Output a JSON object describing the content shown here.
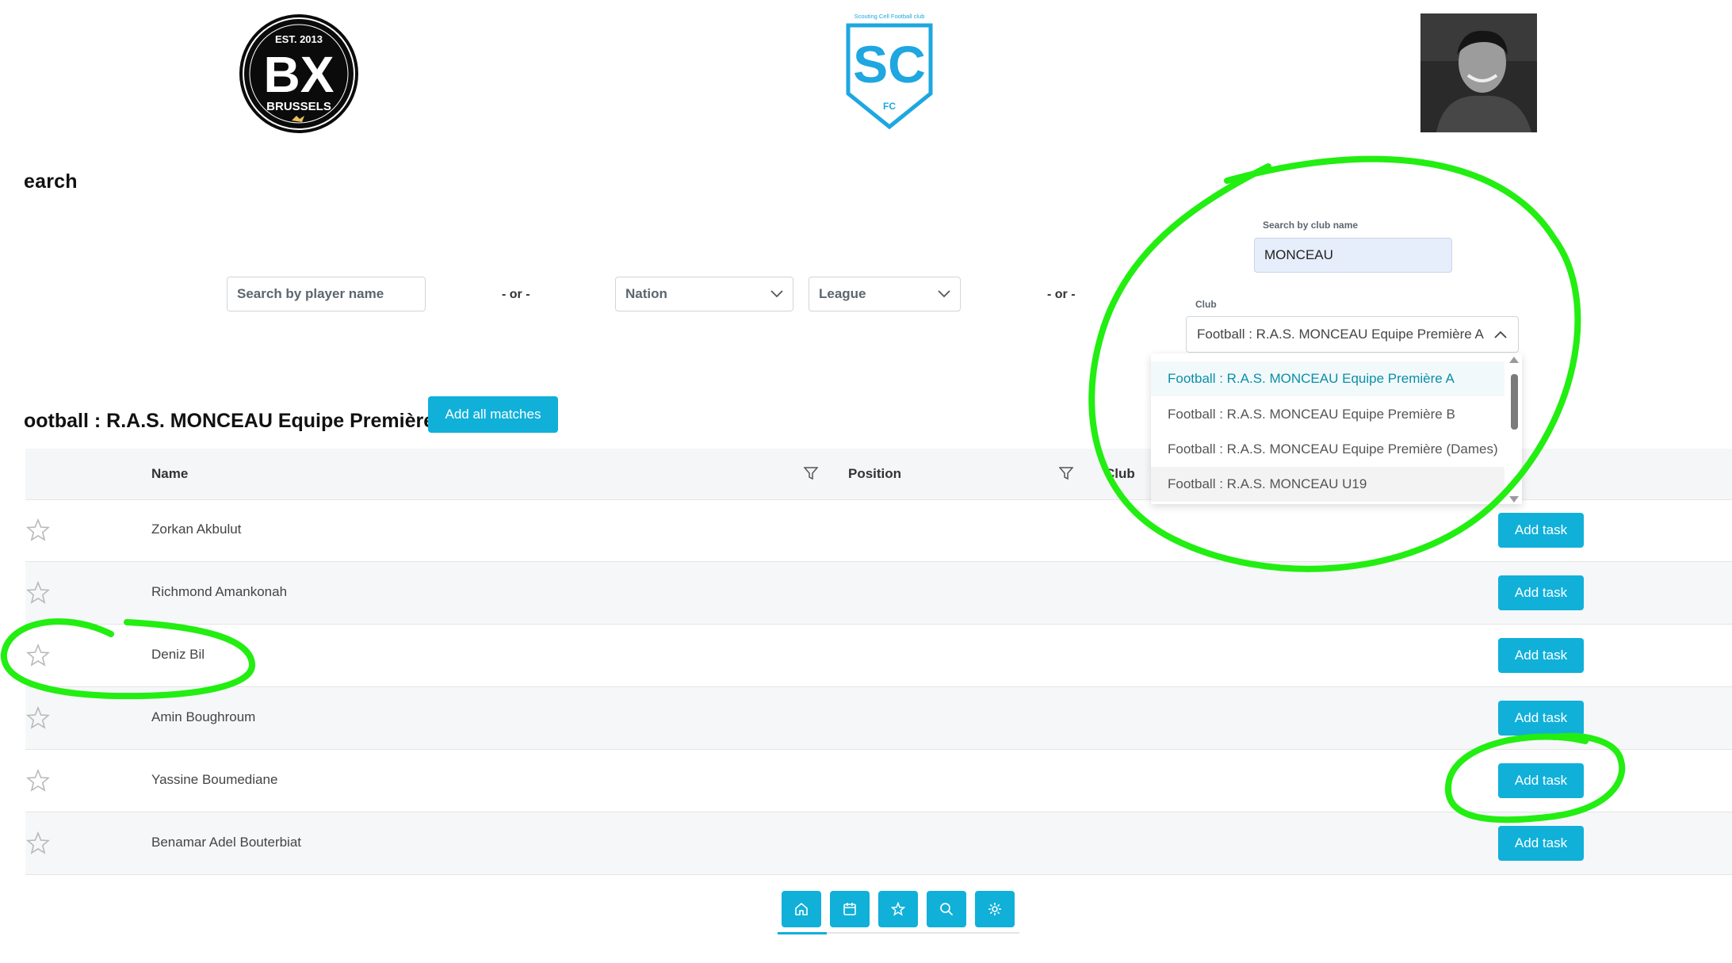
{
  "header": {
    "left_logo": {
      "est": "EST. 2013",
      "initials": "BX",
      "city": "BRUSSELS"
    },
    "center_logo": {
      "caption": "Scouting Cell Football club",
      "initials": "SC",
      "sub": "FC"
    }
  },
  "page": {
    "title": "earch"
  },
  "search": {
    "player_placeholder": "Search by player name",
    "or_label": "- or -",
    "nation_label": "Nation",
    "league_label": "League",
    "club_search_label": "Search by club name",
    "club_search_value": "MONCEAU",
    "club_label": "Club",
    "club_selected": "Football : R.A.S. MONCEAU Equipe Première A",
    "club_options": [
      "Football : R.A.S. MONCEAU Equipe Première A",
      "Football : R.A.S. MONCEAU Equipe Première B",
      "Football : R.A.S. MONCEAU Equipe Première (Dames)",
      "Football : R.A.S. MONCEAU U19"
    ]
  },
  "section": {
    "title": "ootball : R.A.S. MONCEAU Equipe Première A",
    "add_all_label": "Add all matches"
  },
  "table": {
    "columns": [
      "Name",
      "Position",
      "Club"
    ],
    "rows": [
      {
        "name": "Zorkan Akbulut",
        "action": "Add task"
      },
      {
        "name": "Richmond Amankonah",
        "action": "Add task"
      },
      {
        "name": "Deniz Bil",
        "action": "Add task"
      },
      {
        "name": "Amin Boughroum",
        "action": "Add task"
      },
      {
        "name": "Yassine Boumediane",
        "action": "Add task"
      },
      {
        "name": "Benamar Adel Bouterbiat",
        "action": "Add task"
      }
    ]
  },
  "bottom_nav": [
    "home-icon",
    "calendar-icon",
    "star-icon",
    "search-icon",
    "gear-icon"
  ],
  "colors": {
    "accent": "#10b0d9",
    "highlight": "#22ee11"
  }
}
